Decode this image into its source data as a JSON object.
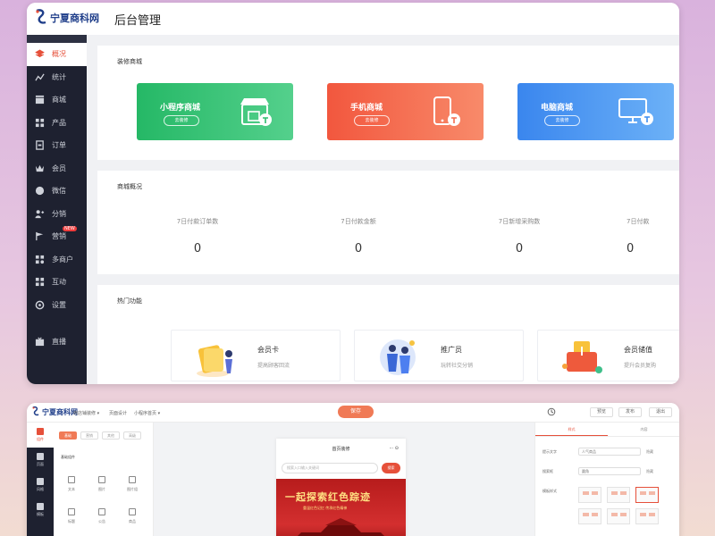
{
  "admin": {
    "logo_text": "宁夏商科网",
    "title": "后台管理",
    "sidebar": {
      "items": [
        {
          "label": "概况",
          "icon": "layers-icon"
        },
        {
          "label": "统计",
          "icon": "chart-line-icon"
        },
        {
          "label": "商城",
          "icon": "store-icon"
        },
        {
          "label": "产品",
          "icon": "grid-icon"
        },
        {
          "label": "订单",
          "icon": "order-icon"
        },
        {
          "label": "会员",
          "icon": "crown-icon"
        },
        {
          "label": "微信",
          "icon": "wechat-icon"
        },
        {
          "label": "分销",
          "icon": "distribution-icon"
        },
        {
          "label": "营销",
          "icon": "flag-icon",
          "badge": "NEW"
        },
        {
          "label": "多商户",
          "icon": "merchant-icon"
        },
        {
          "label": "互动",
          "icon": "interact-icon"
        },
        {
          "label": "设置",
          "icon": "settings-icon"
        },
        {
          "label": "直播",
          "icon": "live-icon"
        }
      ]
    },
    "decor": {
      "title": "装修商城",
      "malls": [
        {
          "label": "小程序商城",
          "button": "去装修",
          "color": "#2dbd6e",
          "icon": "miniapp-store-icon"
        },
        {
          "label": "手机商城",
          "button": "去装修",
          "color": "#f36c4f",
          "icon": "mobile-icon"
        },
        {
          "label": "电脑商城",
          "button": "去装修",
          "color": "#3f8ef0",
          "icon": "desktop-icon"
        }
      ]
    },
    "overview": {
      "title": "商城概况",
      "stats": [
        {
          "label": "7日付款订单数",
          "value": "0"
        },
        {
          "label": "7日付款金额",
          "value": "0"
        },
        {
          "label": "7日新增采购数",
          "value": "0"
        },
        {
          "label": "7日付款",
          "value": "0"
        }
      ]
    },
    "hot": {
      "title": "热门功能",
      "features": [
        {
          "name": "会员卡",
          "desc": "提高顾客回流",
          "icon": "member-card-illustration"
        },
        {
          "name": "推广员",
          "desc": "玩转社交分销",
          "icon": "promoter-illustration"
        },
        {
          "name": "会员储值",
          "desc": "提升会员复购",
          "icon": "stored-value-illustration"
        }
      ]
    }
  },
  "editor": {
    "logo_text": "宁夏商科网",
    "top": {
      "site": "微店铺装修 ▾",
      "design": "页面设计",
      "page": "小程序首页 ▾",
      "save": "保存",
      "history_icon": "history-icon",
      "preview": "预览",
      "publish": "发布",
      "exit": "退出"
    },
    "sidebar": [
      {
        "label": "组件",
        "icon": "component-icon"
      },
      {
        "label": "页面",
        "icon": "page-icon"
      },
      {
        "label": "风格",
        "icon": "style-icon"
      },
      {
        "label": "模板",
        "icon": "template-icon"
      }
    ],
    "panel": {
      "tabs": [
        "基础",
        "营销",
        "其他",
        "高级"
      ],
      "group": "基础组件",
      "components": [
        "文本",
        "图片",
        "图片组",
        "标题",
        "公告",
        "商品"
      ]
    },
    "phone": {
      "title": "首页装修",
      "controls": "··· ⊙",
      "search_placeholder": "搜索入口输入关键词",
      "search_button": "搜索",
      "banner_text": "一起探索红色踪迹",
      "banner_sub": "重温红色记忆 传承红色精神"
    },
    "right": {
      "tabs": [
        "样式",
        "内容"
      ],
      "rows": [
        {
          "label": "提示文字",
          "value": "人气商品",
          "hide": "隐藏"
        },
        {
          "label": "搜索框",
          "value": "圆角",
          "hide": "隐藏"
        },
        {
          "label": "模板样式",
          "value": ""
        }
      ]
    }
  },
  "colors": {
    "accent": "#e6503a",
    "sidebar_bg": "#1e2130",
    "page_bg": "#f0f1f4"
  }
}
